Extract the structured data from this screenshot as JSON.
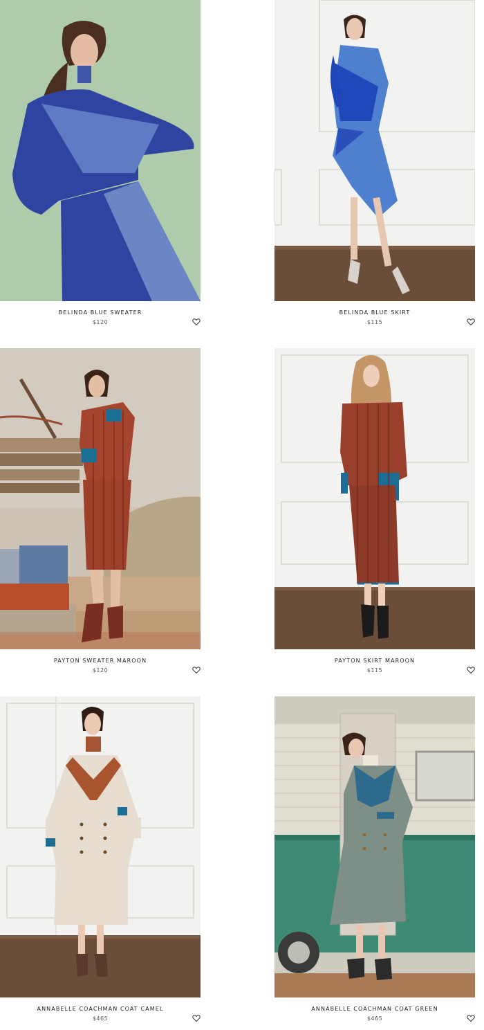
{
  "products": [
    {
      "name": "BELINDA BLUE SWEATER",
      "price": "$120"
    },
    {
      "name": "BELINDA BLUE SKIRT",
      "price": "$115"
    },
    {
      "name": "PAYTON SWEATER MAROON",
      "price": "$120"
    },
    {
      "name": "PAYTON SKIRT MAROON",
      "price": "$115"
    },
    {
      "name": "ANNABELLE COACHMAN COAT CAMEL",
      "price": "$465"
    },
    {
      "name": "ANNABELLE COACHMAN COAT GREEN",
      "price": "$465"
    }
  ],
  "icons": {
    "wishlist": "heart-outline-icon"
  },
  "colors": {
    "text": "#222222",
    "price": "#555555",
    "belinda_blue": "#2f49a8",
    "payton_maroon": "#9a3f2c",
    "teal_accent": "#1d6f8c",
    "coat_camel": "#e6ddd0",
    "coat_green": "#7d8f86"
  }
}
